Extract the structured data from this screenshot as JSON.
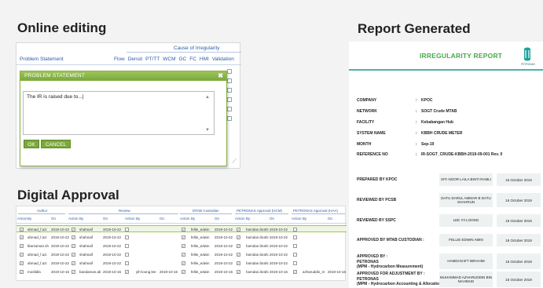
{
  "headings": {
    "online_editing": "Online editing",
    "report_generated": "Report Generated",
    "digital_approval": "Digital Approval"
  },
  "editor": {
    "group_header": "Cause of Irregularity",
    "problem_statement_col": "Problem Statement",
    "columns": [
      "Flow",
      "Densit",
      "PT/TT",
      "WCM",
      "GC",
      "FC",
      "HMI",
      "Validation"
    ],
    "dialog_title": "PROBLEM STATEMENT",
    "close_glyph": "✖",
    "textarea_value": "The IR is raised due to...|",
    "ok_label": "OK",
    "cancel_label": "CANCEL"
  },
  "report": {
    "title": "IRREGULARITY REPORT",
    "logo_text": "PETRONAS",
    "brand_color": "#4bb0ad",
    "info": [
      {
        "label": "COMPANY",
        "value": "KPOC"
      },
      {
        "label": "NETWORK",
        "value": "SOGT Crude MTAB"
      },
      {
        "label": "FACILITY",
        "value": "Kebabangan Hub"
      },
      {
        "label": "SYSTEM NAME",
        "value": "KBBH CRUDE METER"
      },
      {
        "label": "MONTH",
        "value": "Sep-19"
      },
      {
        "label": "REFERENCE NO",
        "value": "IR-SOGT_CRUDE-KBBH-2019-09-001 Rev. 0"
      }
    ],
    "signoffs": [
      {
        "label": "PREPARED BY KPOC",
        "name": "SITI NOOR LAILA BINTI RAMLI",
        "date": "16 October 2019"
      },
      {
        "label": "REVIEWED BY PCSB",
        "name": "DATU DARUL AMMAR B DATU SHAHRUN",
        "date": "16 October 2019"
      },
      {
        "label": "REVIEWED BY SSPC",
        "name": "LEE YII LOONG",
        "date": "16 October 2019"
      },
      {
        "label": "APPROVED BY MTAB CUSTODIAN :",
        "name": "FELLIE EDWIN AMIN",
        "date": "18 October 2019"
      },
      {
        "label": "APPROVED BY :\nPETRONAS\n(MPM - Hydrocarbon Measurement)",
        "name": "HAMDAN B'T IBRAHIM",
        "date": "16 October 2019"
      },
      {
        "label": "APPROVED FOR ADJUSTMENT BY :\nPETRONAS\n(MPM - Hydrocarbon Accounting & Allocation)",
        "name": "MUHAMMAD AZHARUDDIN BIN MAHMUD",
        "date": "16 October 2019"
      }
    ]
  },
  "approval": {
    "groups": [
      "Author",
      "Review",
      "MTAB Custodian",
      "PETRONAS Approval (HCM)",
      "PETRONAS Approval (HAA)"
    ],
    "sub_headers": [
      "Action",
      "By",
      "On"
    ],
    "rows": [
      {
        "a_check": true,
        "a_by": "ahmad_f.azi",
        "a_on": "2019-10-22",
        "r_check": true,
        "r_by": "shahnaif",
        "r_on": "2019-10-22",
        "r_check2": false,
        "r_by2": "",
        "r_on2": "",
        "m_check": true,
        "m_by": "fellie_edwin",
        "m_on": "2019-10-22",
        "h_check": true,
        "h_by": "hamdan.ibrahi",
        "h_on": "2019-10-22",
        "x_check": false,
        "x_by": "",
        "x_on": "",
        "selected": true
      },
      {
        "a_check": true,
        "a_by": "ahmad_f.azi",
        "a_on": "2019-10-22",
        "r_check": true,
        "r_by": "shahnaif",
        "r_on": "2019-10-22",
        "r_check2": false,
        "r_by2": "",
        "r_on2": "",
        "m_check": true,
        "m_by": "fellie_edwin",
        "m_on": "2019-10-22",
        "h_check": true,
        "h_by": "hamdan.ibrahi",
        "h_on": "2019-10-22",
        "x_check": false,
        "x_by": "",
        "x_on": "",
        "selected": false
      },
      {
        "a_check": true,
        "a_by": "lbarzaman.sh",
        "a_on": "2019-10-22",
        "r_check": true,
        "r_by": "shahnaif",
        "r_on": "2019-10-22",
        "r_check2": false,
        "r_by2": "",
        "r_on2": "",
        "m_check": true,
        "m_by": "fellie_edwin",
        "m_on": "2019-10-22",
        "h_check": true,
        "h_by": "hamdan.ibrahi",
        "h_on": "2019-10-22",
        "x_check": false,
        "x_by": "",
        "x_on": "",
        "selected": false
      },
      {
        "a_check": true,
        "a_by": "ahmad_f.azi",
        "a_on": "2019-10-22",
        "r_check": true,
        "r_by": "shahnaif",
        "r_on": "2019-10-22",
        "r_check2": false,
        "r_by2": "",
        "r_on2": "",
        "m_check": true,
        "m_by": "fellie_edwin",
        "m_on": "2019-10-22",
        "h_check": true,
        "h_by": "hamdan.ibrahi",
        "h_on": "2019-10-22",
        "x_check": false,
        "x_by": "",
        "x_on": "",
        "selected": false
      },
      {
        "a_check": true,
        "a_by": "ahmad_f.azi",
        "a_on": "2019-10-22",
        "r_check": true,
        "r_by": "shahnaif",
        "r_on": "2019-10-22",
        "r_check2": false,
        "r_by2": "",
        "r_on2": "",
        "m_check": true,
        "m_by": "fellie_edwin",
        "m_on": "2019-10-22",
        "h_check": true,
        "h_by": "hamdan.ibrahi",
        "h_on": "2019-10-22",
        "x_check": false,
        "x_by": "",
        "x_on": "",
        "selected": false
      },
      {
        "a_check": true,
        "a_by": "mosfalla",
        "a_on": "2019-10-16",
        "r_check": true,
        "r_by": "bandaman.ab",
        "r_on": "2019-10-16",
        "r_check2": true,
        "r_by2": "yih-loong.lee",
        "r_on2": "2019-10-16",
        "m_check": true,
        "m_by": "fellie_edwin",
        "m_on": "2019-10-16",
        "h_check": true,
        "h_by": "hamdan.ibrahi",
        "h_on": "2019-10-16",
        "x_check": true,
        "x_by": "azharuddin_m",
        "x_on": "2019-10-16",
        "selected": false
      }
    ]
  }
}
